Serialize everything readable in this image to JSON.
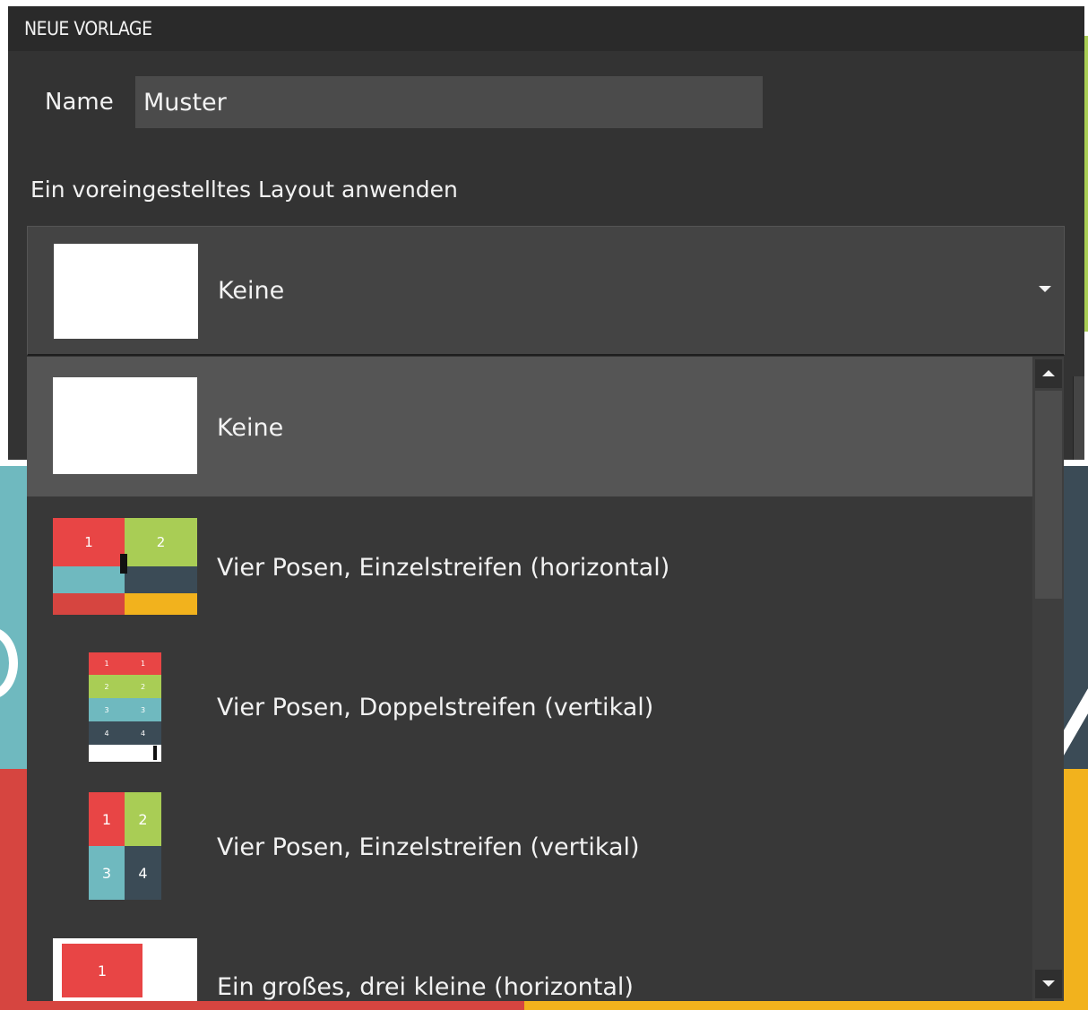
{
  "dialog": {
    "title": "NEUE VORLAGE",
    "name_label": "Name",
    "name_value": "Muster",
    "layout_label": "Ein voreingestelltes Layout anwenden"
  },
  "combo": {
    "selected_label": "Keine",
    "arrow_icon": "chevron-down-icon"
  },
  "dropdown": {
    "items": [
      {
        "label": "Keine",
        "thumbnail": "blank",
        "selected": true
      },
      {
        "label": "Vier Posen, Einzelstreifen (horizontal)",
        "thumbnail": "four-poses-horizontal",
        "cells": [
          "1",
          "2",
          "",
          ""
        ]
      },
      {
        "label": "Vier Posen, Doppelstreifen (vertikal)",
        "thumbnail": "four-poses-double-vertical",
        "cells": [
          "1",
          "1",
          "2",
          "2",
          "3",
          "3",
          "4",
          "4"
        ]
      },
      {
        "label": "Vier Posen, Einzelstreifen (vertikal)",
        "thumbnail": "four-poses-vertical",
        "cells": [
          "1",
          "2",
          "3",
          "4"
        ]
      },
      {
        "label": "Ein großes, drei kleine (horizontal)",
        "thumbnail": "one-large-three-small",
        "cells": [
          "1"
        ]
      }
    ]
  },
  "colors": {
    "cell_red": "#e84545",
    "cell_green": "#a9cd55",
    "cell_teal": "#6fb9bf",
    "cell_slate": "#3b4b56",
    "dialog_bg": "#333333",
    "selected_bg": "#555555"
  }
}
